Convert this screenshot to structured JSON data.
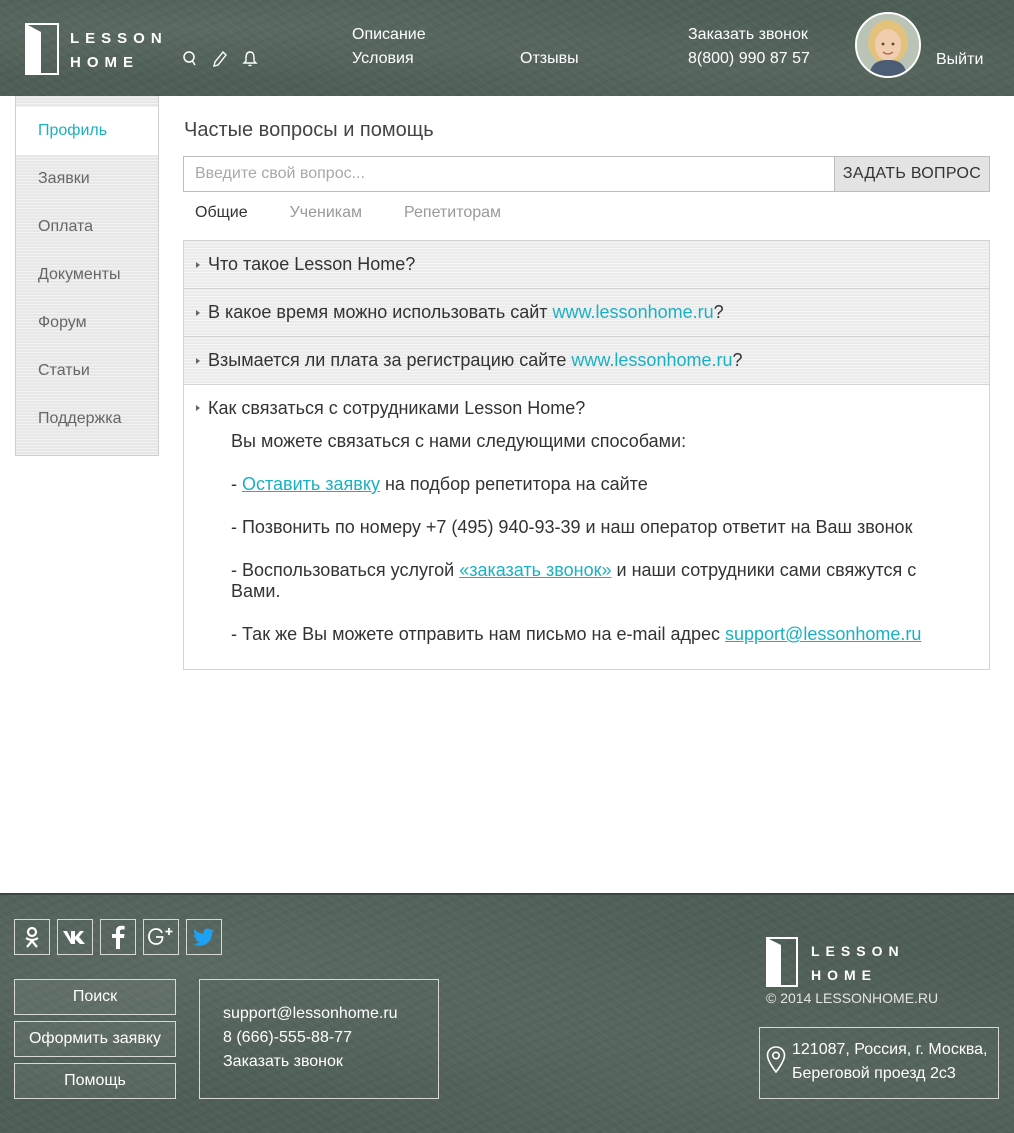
{
  "header": {
    "logo_line1": "LESSON",
    "logo_line2": "HOME",
    "nav": {
      "description": "Описание",
      "conditions": "Условия",
      "reviews": "Отзывы",
      "callback": "Заказать звонок",
      "phone": "8(800) 990 87 57"
    },
    "logout": "Выйти",
    "icons": [
      "search-icon",
      "pencil-icon",
      "bell-icon"
    ]
  },
  "sidebar": {
    "items": [
      {
        "label": "Профиль",
        "active": true
      },
      {
        "label": "Заявки"
      },
      {
        "label": "Оплата"
      },
      {
        "label": "Документы"
      },
      {
        "label": "Форум"
      },
      {
        "label": "Статьи"
      },
      {
        "label": "Поддержка"
      }
    ]
  },
  "main": {
    "title": "Частые вопросы и помощь",
    "search": {
      "placeholder": "Введите свой вопрос...",
      "value": "",
      "button": "ЗАДАТЬ ВОПРОС"
    },
    "tabs": [
      {
        "label": "Общие",
        "active": true
      },
      {
        "label": "Ученикам"
      },
      {
        "label": "Репетиторам"
      }
    ],
    "faq": [
      {
        "question": "Что такое Lesson Home?"
      },
      {
        "question_pre": "В какое время можно использовать сайт ",
        "question_link": "www.lessonhome.ru",
        "question_post": "?"
      },
      {
        "question_pre": "Взымается ли плата за регистрацию сайте ",
        "question_link": "www.lessonhome.ru",
        "question_post": "?"
      }
    ],
    "open_faq": {
      "question": "Как связаться с сотрудниками Lesson Home?",
      "intro": "Вы можете связаться с нами следующими способами:",
      "line1_pre": "- ",
      "line1_link": "Оставить заявку",
      "line1_post": " на подбор репетитора на сайте",
      "line2": "- Позвонить по номеру  +7 (495) 940-93-39 и наш оператор ответит на Ваш звонок",
      "line3_pre": "-  Воспользоваться услугой ",
      "line3_link": "«заказать звонок»",
      "line3_post": " и наши сотрудники сами свяжутся с Вами.",
      "line4_pre": "- Так же Вы можете отправить нам письмо на e-mail адрес ",
      "line4_link": "support@lessonhome.ru"
    }
  },
  "footer": {
    "socials": [
      "odnoklassniki-icon",
      "vk-icon",
      "facebook-icon",
      "google-plus-icon",
      "twitter-icon"
    ],
    "buttons": {
      "search": "Поиск",
      "apply": "Оформить заявку",
      "help": "Помощь"
    },
    "contact": {
      "email": "support@lessonhome.ru",
      "phone": "8 (666)-555-88-77",
      "callback": "Заказать звонок"
    },
    "logo_line1": "LESSON",
    "logo_line2": "HOME",
    "copyright": "© 2014 LESSONHOME.RU",
    "address_line1": "121087, Россия, г. Москва,",
    "address_line2": "Береговой проезд 2с3"
  },
  "colors": {
    "accent": "#1ab0c4",
    "chalkboard": "#4f5f56",
    "twitter": "#1da1f2"
  }
}
